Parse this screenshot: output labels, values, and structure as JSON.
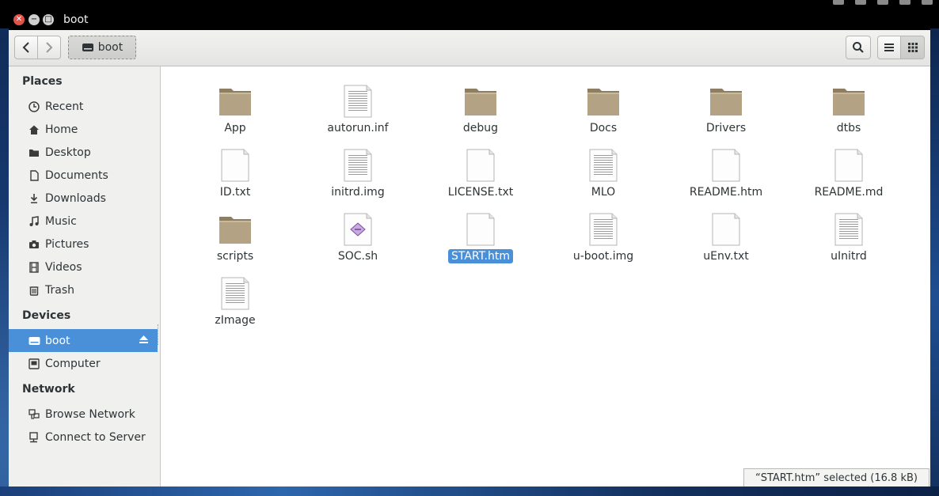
{
  "window": {
    "title": "boot"
  },
  "toolbar": {
    "path_label": "boot"
  },
  "sidebar": {
    "places_title": "Places",
    "places": [
      {
        "label": "Recent",
        "icon": "clock-icon"
      },
      {
        "label": "Home",
        "icon": "home-icon"
      },
      {
        "label": "Desktop",
        "icon": "folder-icon"
      },
      {
        "label": "Documents",
        "icon": "document-icon"
      },
      {
        "label": "Downloads",
        "icon": "download-icon"
      },
      {
        "label": "Music",
        "icon": "music-icon"
      },
      {
        "label": "Pictures",
        "icon": "camera-icon"
      },
      {
        "label": "Videos",
        "icon": "film-icon"
      },
      {
        "label": "Trash",
        "icon": "trash-icon"
      }
    ],
    "devices_title": "Devices",
    "devices": [
      {
        "label": "boot",
        "icon": "drive-icon",
        "selected": true
      },
      {
        "label": "Computer",
        "icon": "computer-icon"
      }
    ],
    "network_title": "Network",
    "network": [
      {
        "label": "Browse Network",
        "icon": "network-icon"
      },
      {
        "label": "Connect to Server",
        "icon": "server-icon"
      }
    ]
  },
  "files": [
    {
      "name": "App",
      "type": "folder"
    },
    {
      "name": "autorun.inf",
      "type": "text"
    },
    {
      "name": "debug",
      "type": "folder"
    },
    {
      "name": "Docs",
      "type": "folder"
    },
    {
      "name": "Drivers",
      "type": "folder"
    },
    {
      "name": "dtbs",
      "type": "folder"
    },
    {
      "name": "ID.txt",
      "type": "blank"
    },
    {
      "name": "initrd.img",
      "type": "text"
    },
    {
      "name": "LICENSE.txt",
      "type": "blank"
    },
    {
      "name": "MLO",
      "type": "text"
    },
    {
      "name": "README.htm",
      "type": "blank"
    },
    {
      "name": "README.md",
      "type": "blank"
    },
    {
      "name": "scripts",
      "type": "folder"
    },
    {
      "name": "SOC.sh",
      "type": "script"
    },
    {
      "name": "START.htm",
      "type": "blank",
      "selected": true
    },
    {
      "name": "u-boot.img",
      "type": "text"
    },
    {
      "name": "uEnv.txt",
      "type": "blank"
    },
    {
      "name": "uInitrd",
      "type": "text"
    },
    {
      "name": "zImage",
      "type": "text"
    }
  ],
  "status": {
    "text": "“START.htm” selected  (16.8 kB)"
  },
  "colors": {
    "selection": "#4a90d9",
    "folder": "#b3a283"
  }
}
